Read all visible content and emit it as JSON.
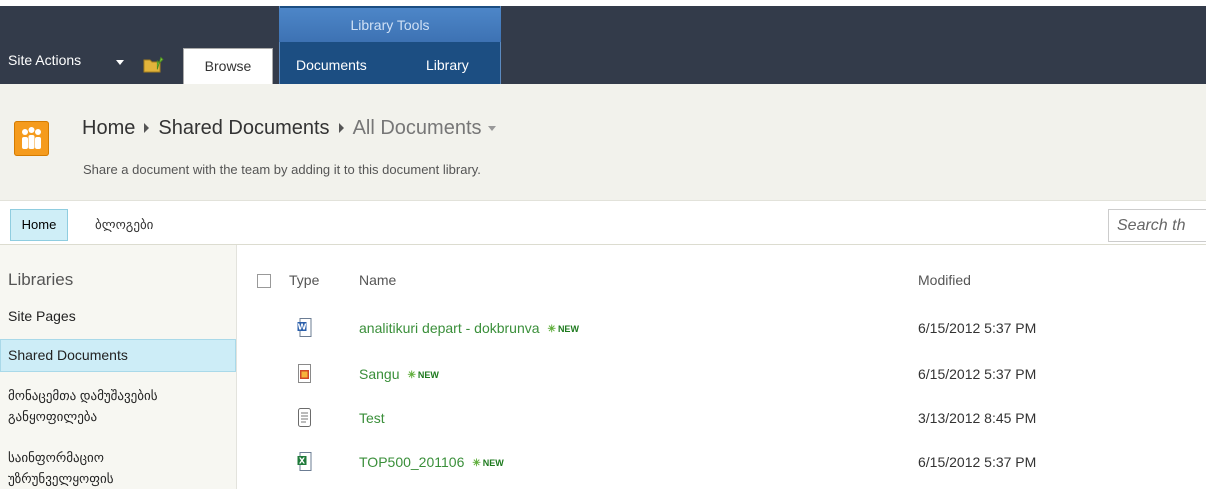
{
  "ribbon": {
    "site_actions": "Site Actions",
    "tab_group_label": "Library Tools",
    "tabs": [
      "Browse",
      "Documents",
      "Library"
    ]
  },
  "title_area": {
    "breadcrumb": [
      "Home",
      "Shared Documents",
      "All Documents"
    ],
    "description": "Share a document with the team by adding it to this document library."
  },
  "top_nav": {
    "items": [
      "Home",
      "ბლოგები"
    ],
    "search_placeholder": "Search th"
  },
  "quick_launch": {
    "heading": "Libraries",
    "items": [
      "Site Pages",
      "Shared Documents",
      "მონაცემთა დამუშავების განყოფილება",
      "საინფორმაციო უზრუნველყოფის"
    ]
  },
  "list": {
    "columns": [
      "Type",
      "Name",
      "Modified"
    ],
    "new_label": "NEW",
    "rows": [
      {
        "name": "analitikuri depart - dokbrunva",
        "modified": "6/15/2012 5:37 PM",
        "icon": "word-doc-icon",
        "is_new": true
      },
      {
        "name": "Sangu",
        "modified": "6/15/2012 5:37 PM",
        "icon": "powerpoint-doc-icon",
        "is_new": true
      },
      {
        "name": "Test",
        "modified": "3/13/2012 8:45 PM",
        "icon": "text-doc-icon",
        "is_new": false
      },
      {
        "name": "TOP500_201106",
        "modified": "6/15/2012 5:37 PM",
        "icon": "excel-doc-icon",
        "is_new": true
      }
    ]
  },
  "colors": {
    "ribbon_bg": "#333b4a",
    "tools_group": "#3d72b3",
    "link_green": "#3a8f3a",
    "selected_nav": "#cdedf7"
  }
}
